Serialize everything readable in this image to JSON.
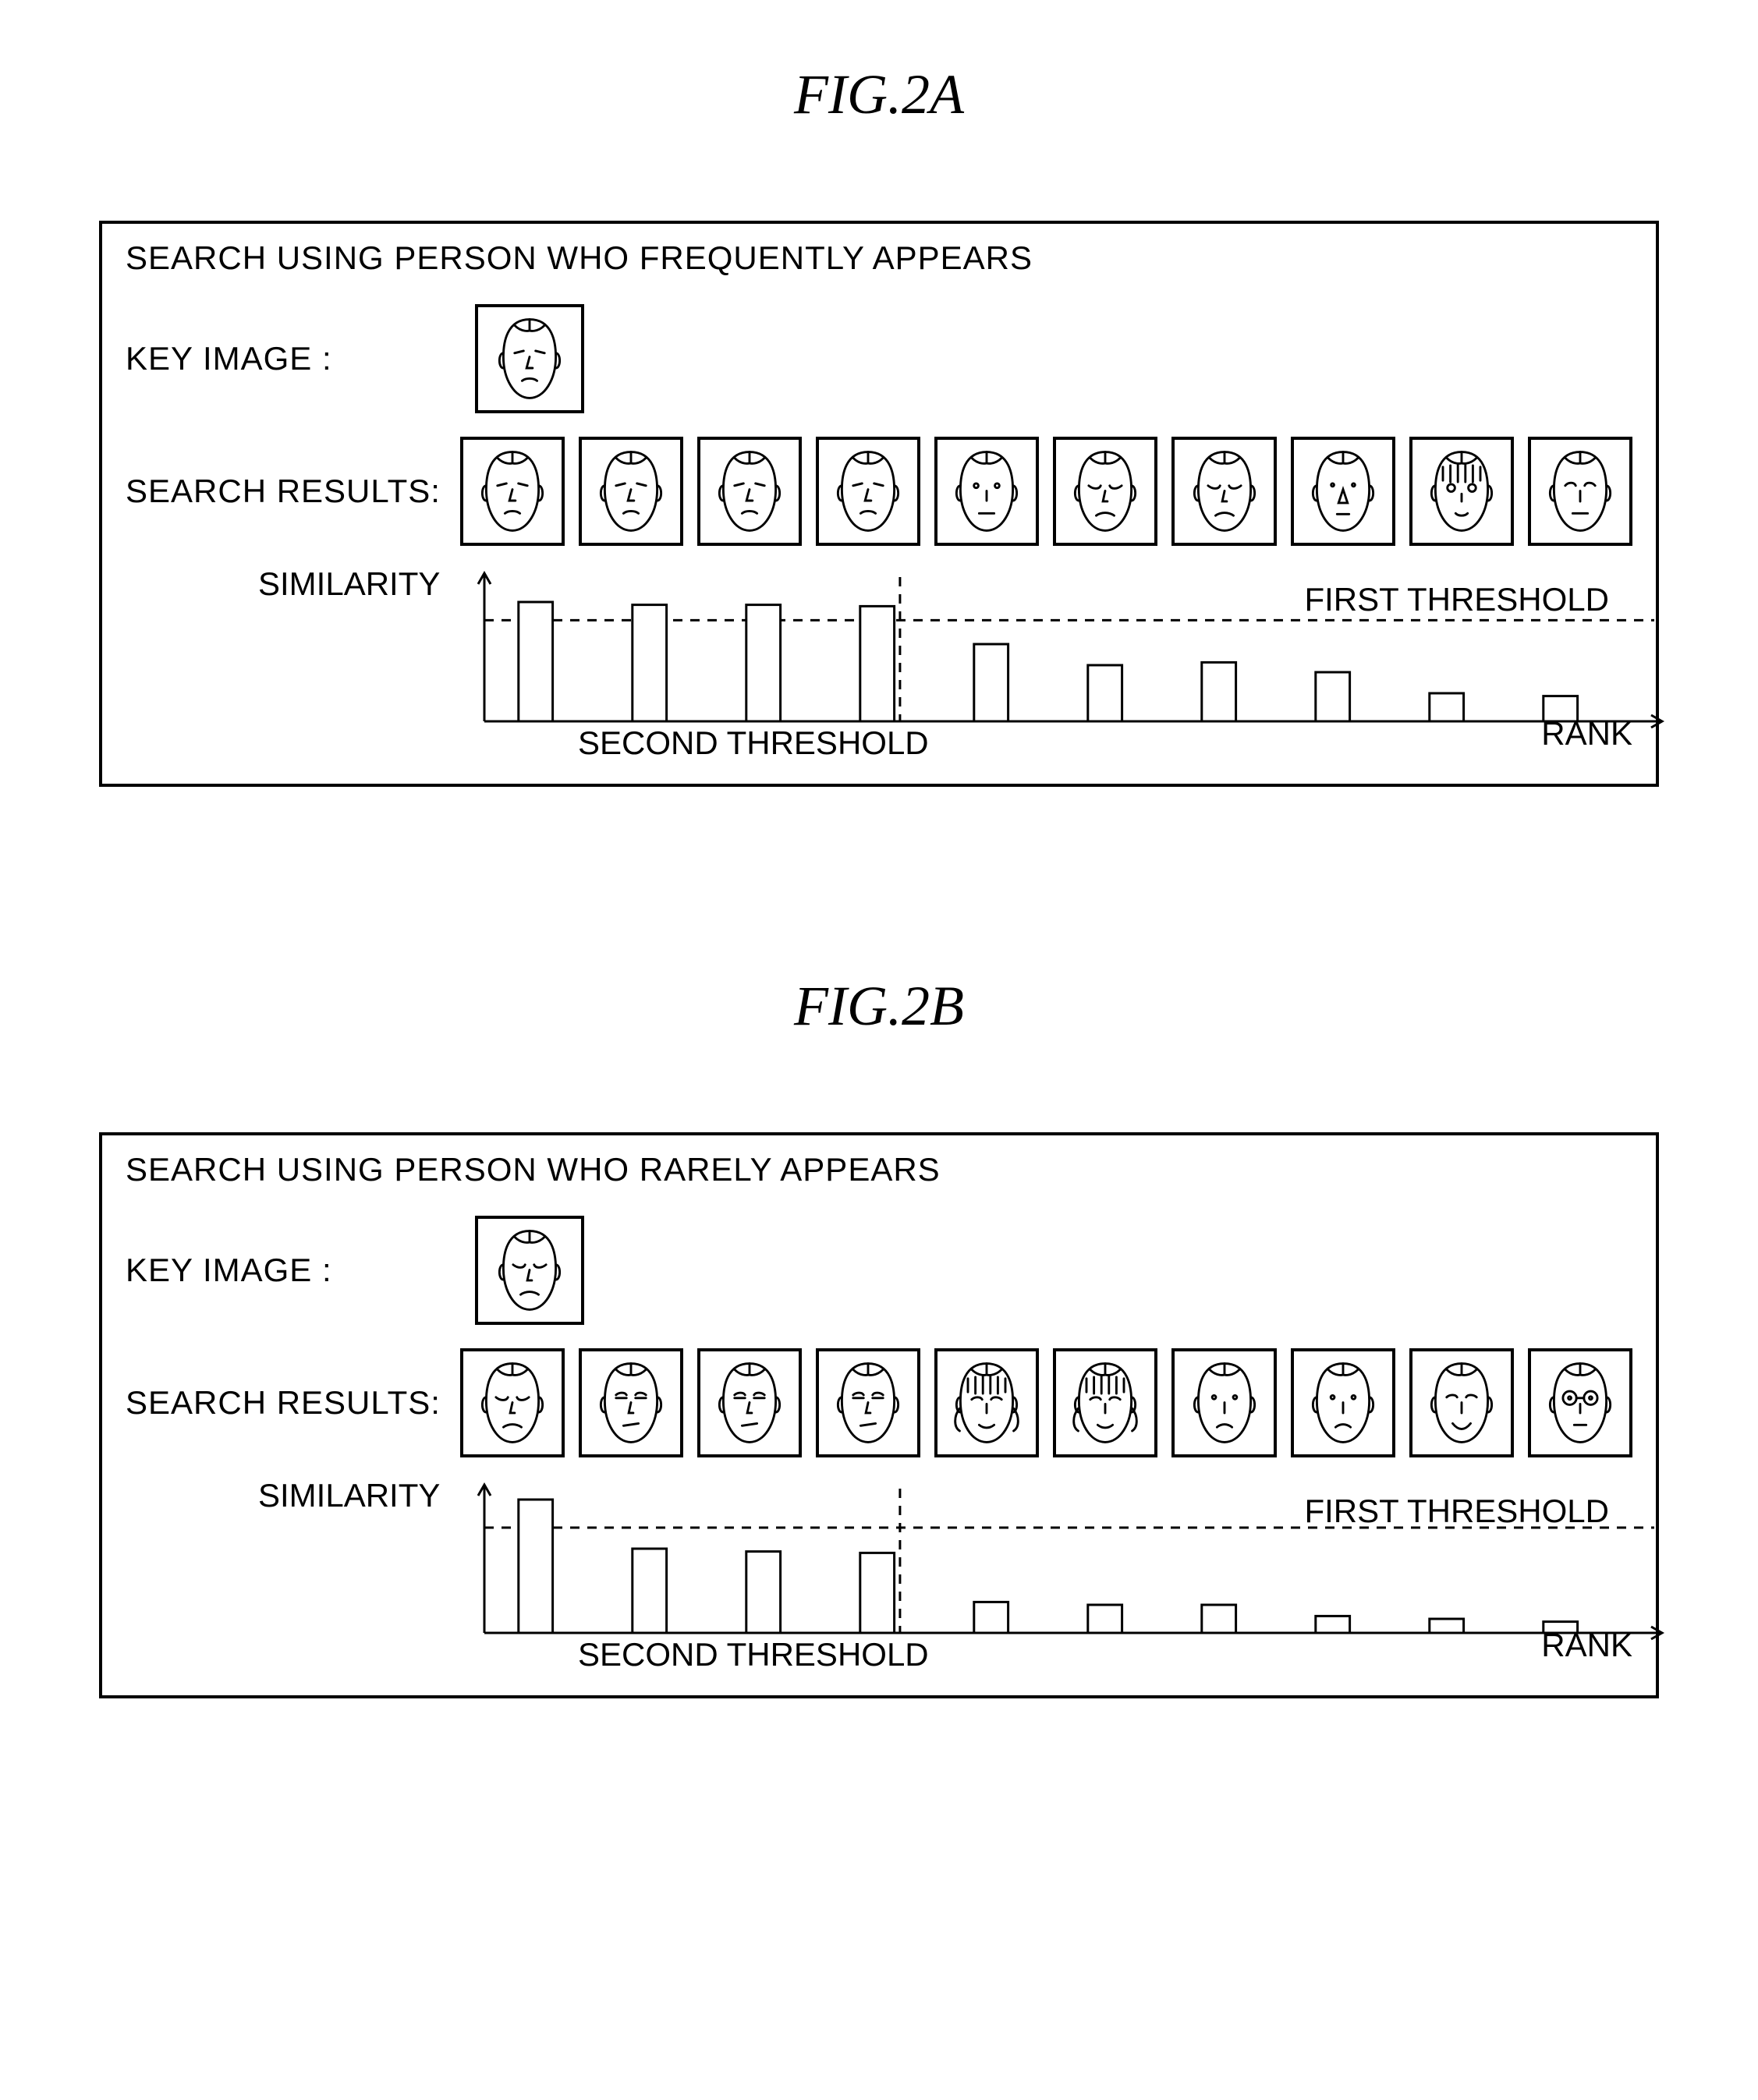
{
  "fig2a": {
    "title": "FIG.2A",
    "panel_title": "SEARCH USING PERSON WHO FREQUENTLY APPEARS",
    "label_key": "KEY IMAGE :",
    "label_results": "SEARCH RESULTS:",
    "label_similarity": "SIMILARITY",
    "label_rank": "RANK",
    "label_first": "FIRST THRESHOLD",
    "label_second": "SECOND THRESHOLD",
    "key_face": 0,
    "result_faces": [
      0,
      0,
      0,
      0,
      1,
      2,
      2,
      3,
      4,
      5
    ]
  },
  "fig2b": {
    "title": "FIG.2B",
    "panel_title": "SEARCH USING PERSON WHO RARELY APPEARS",
    "label_key": "KEY IMAGE :",
    "label_results": "SEARCH RESULTS:",
    "label_similarity": "SIMILARITY",
    "label_rank": "RANK",
    "label_first": "FIRST THRESHOLD",
    "label_second": "SECOND THRESHOLD",
    "key_face": 2,
    "result_faces": [
      2,
      6,
      6,
      6,
      7,
      7,
      8,
      8,
      9,
      10
    ]
  },
  "chart_data": [
    {
      "type": "bar",
      "title": "FIG.2A similarity vs rank",
      "xlabel": "RANK",
      "ylabel": "SIMILARITY",
      "categories": [
        1,
        2,
        3,
        4,
        5,
        6,
        7,
        8,
        9,
        10
      ],
      "values": [
        0.85,
        0.83,
        0.83,
        0.82,
        0.55,
        0.4,
        0.42,
        0.35,
        0.2,
        0.18
      ],
      "ylim": [
        0,
        1
      ],
      "first_threshold": 0.72,
      "second_threshold_rank": 3.5,
      "annotations": [
        "FIRST THRESHOLD",
        "SECOND THRESHOLD"
      ]
    },
    {
      "type": "bar",
      "title": "FIG.2B similarity vs rank",
      "xlabel": "RANK",
      "ylabel": "SIMILARITY",
      "categories": [
        1,
        2,
        3,
        4,
        5,
        6,
        7,
        8,
        9,
        10
      ],
      "values": [
        0.95,
        0.6,
        0.58,
        0.57,
        0.22,
        0.2,
        0.2,
        0.12,
        0.1,
        0.08
      ],
      "ylim": [
        0,
        1
      ],
      "first_threshold": 0.75,
      "second_threshold_rank": 3.5,
      "annotations": [
        "FIRST THRESHOLD",
        "SECOND THRESHOLD"
      ]
    }
  ]
}
